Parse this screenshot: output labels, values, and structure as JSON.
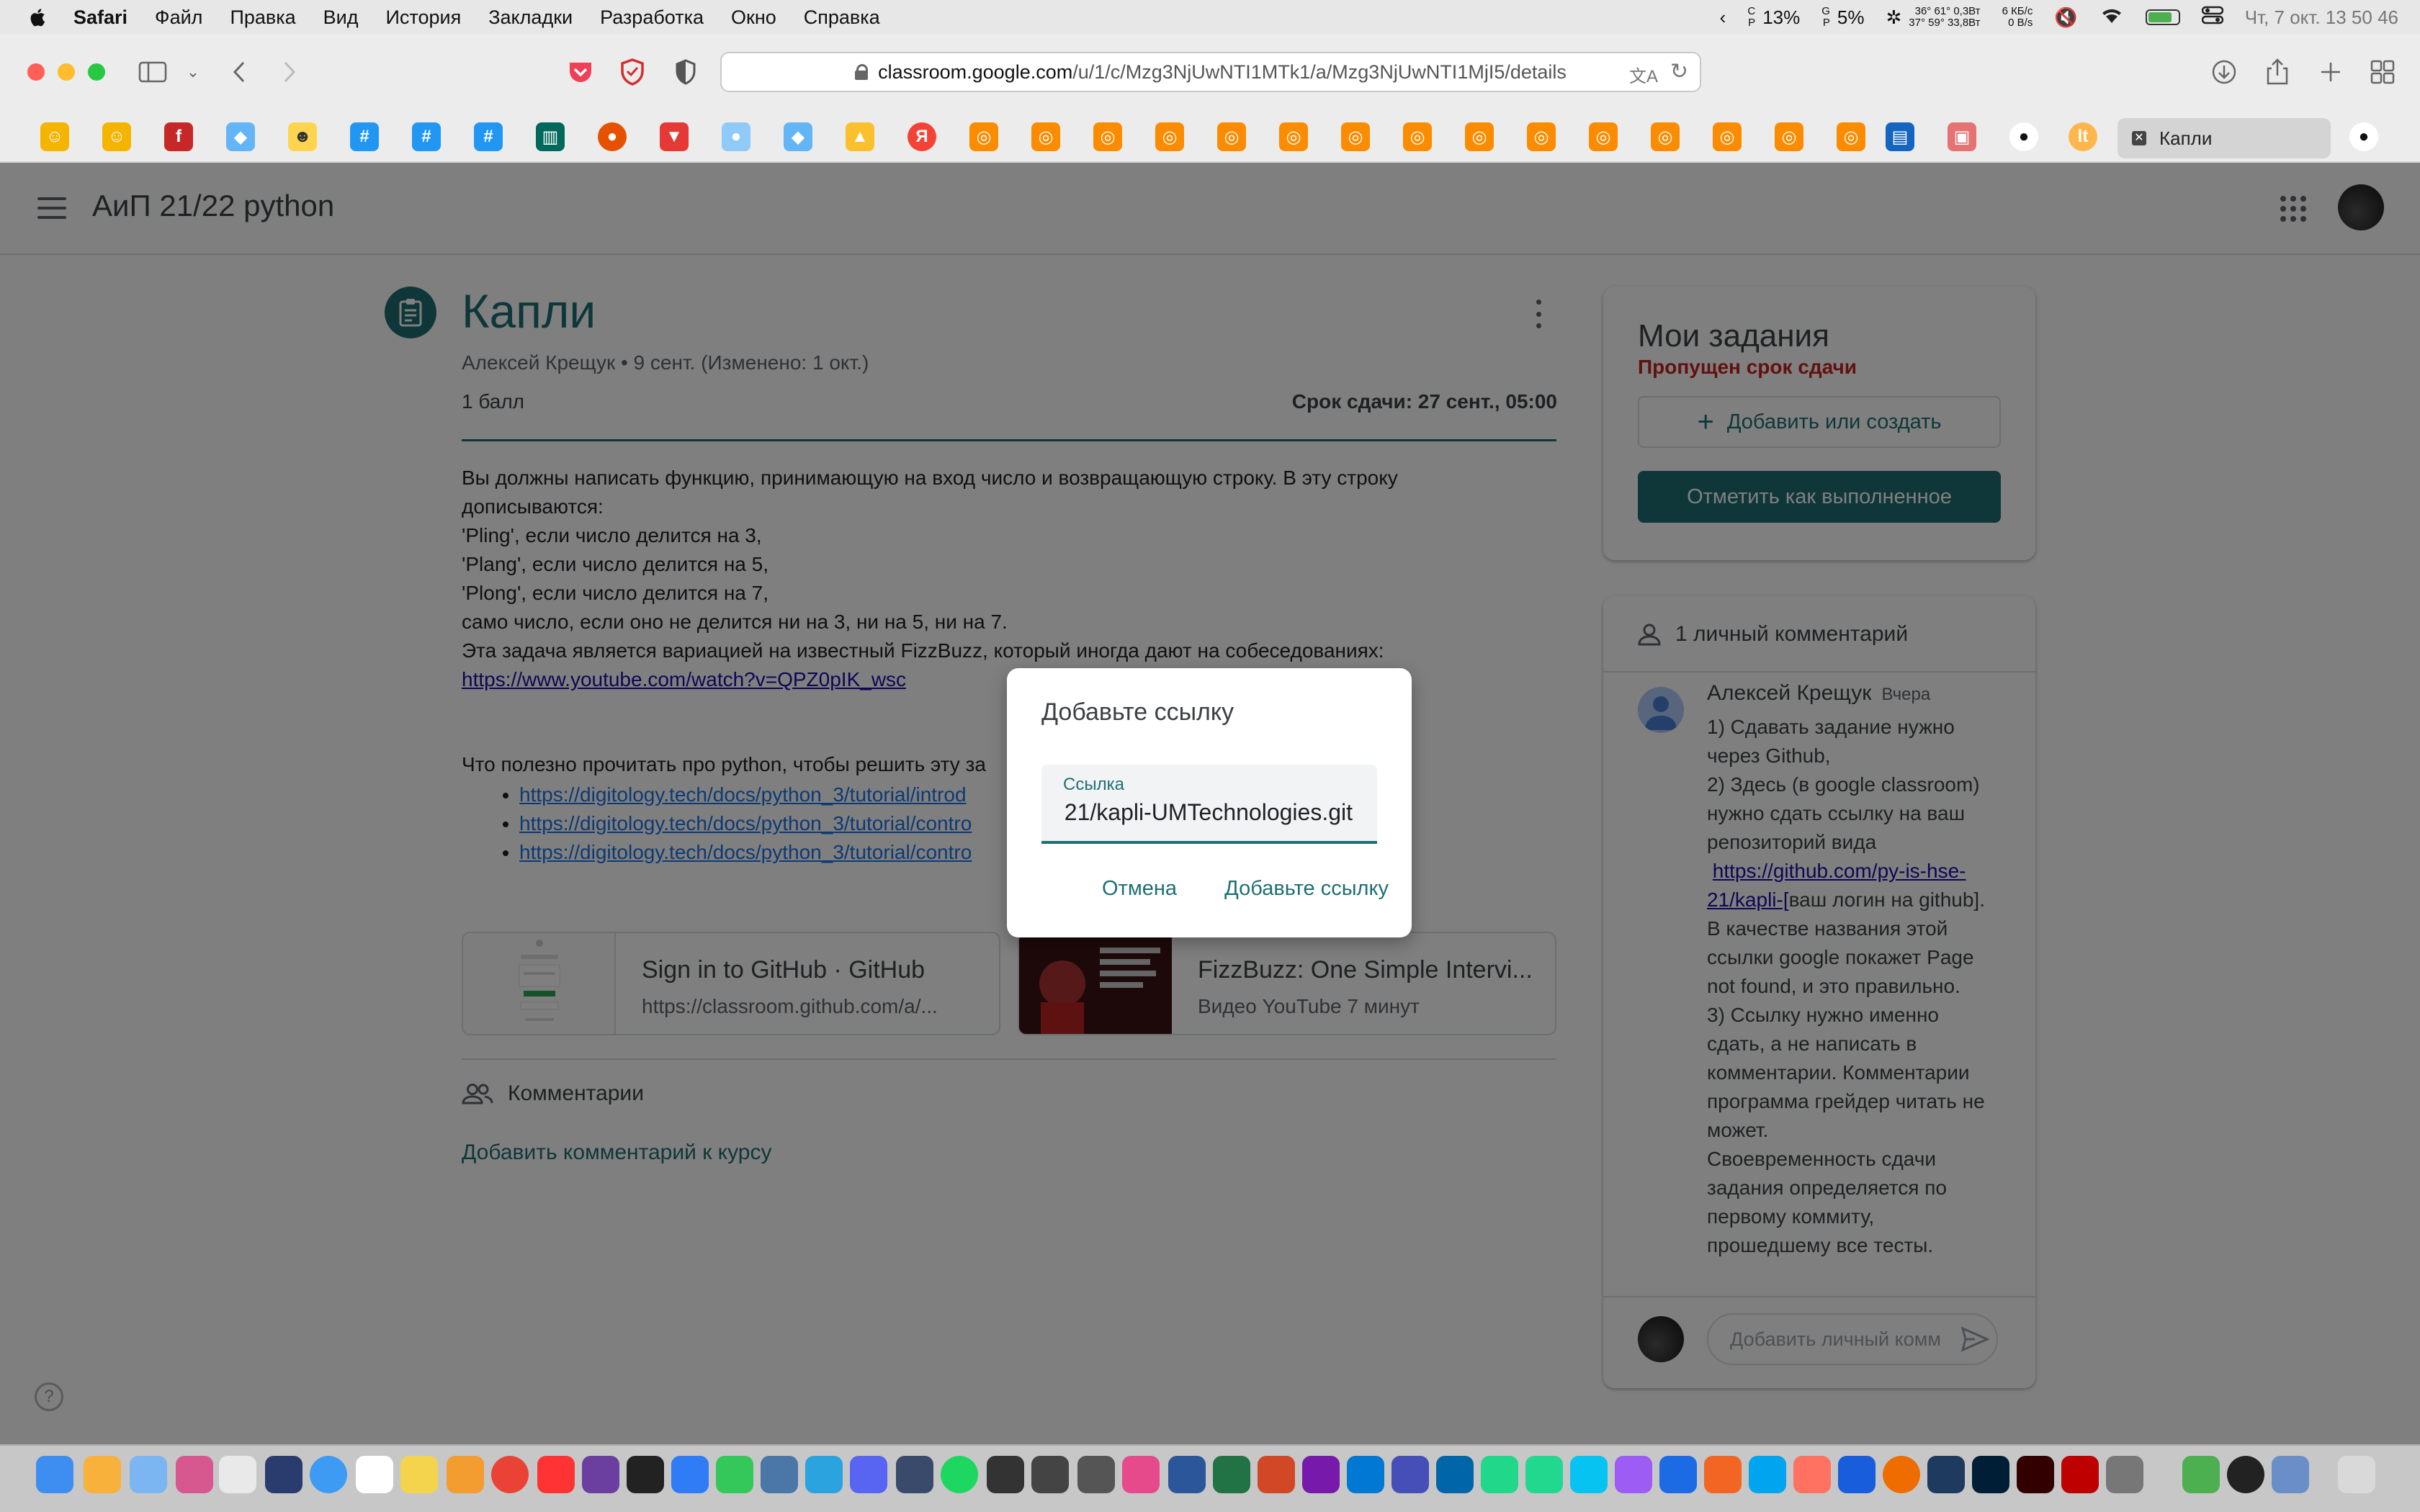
{
  "menubar": {
    "app": "Safari",
    "items": [
      "Файл",
      "Правка",
      "Вид",
      "История",
      "Закладки",
      "Разработка",
      "Окно",
      "Справка"
    ],
    "cpu": "13%",
    "gpu": "5%",
    "temps_top": "36° 61° 0,3Вт",
    "temps_bottom": "37° 59° 33,8Вт",
    "net_up": "6 КБ/с",
    "net_down": "0 B/s",
    "clock": "Чт, 7 окт.  13 50 46"
  },
  "browser": {
    "url_host": "classroom.google.com",
    "url_path": "/u/1/c/Mzg3NjUwNTI1MTk1/a/Mzg3NjUwNTI1MjI5/details",
    "active_tab": "Капли"
  },
  "classroom": {
    "course_title": "АиП 21/22 python",
    "task": {
      "title": "Капли",
      "meta": "Алексей Крещук • 9 сент. (Изменено: 1 окт.)",
      "points": "1 балл",
      "due": "Срок сдачи: 27 сент., 05:00",
      "body_lines": [
        "Вы должны написать функцию, принимающую на вход число и возвращающую строку. В эту строку",
        "дописываются:",
        "'Pling', если число делится на 3,",
        "'Plang', если число делится на 5,",
        "'Plong', если число делится на 7,",
        "само число, если оно не делится ни на 3, ни на 5, ни на 7.",
        "Эта задача является вариацией на известный FizzBuzz, который иногда дают на собеседованиях:"
      ],
      "youtube_link": "https://www.youtube.com/watch?v=QPZ0pIK_wsc",
      "read_label": "Что полезно прочитать про python, чтобы решить эту за",
      "read_links": [
        "https://digitology.tech/docs/python_3/tutorial/introd",
        "https://digitology.tech/docs/python_3/tutorial/contro",
        "https://digitology.tech/docs/python_3/tutorial/contro"
      ]
    },
    "attachments": [
      {
        "title": "Sign in to GitHub · GitHub",
        "subtitle": "https://classroom.github.com/a/..."
      },
      {
        "title": "FizzBuzz: One Simple Intervi...",
        "subtitle": "Видео YouTube   7 минут"
      }
    ],
    "class_comments": {
      "header": "Комментарии",
      "add": "Добавить комментарий к курсу"
    },
    "my_work": {
      "title": "Мои задания",
      "status": "Пропущен срок сдачи",
      "add_button": "Добавить или создать",
      "done_button": "Отметить как выполненное"
    },
    "private_comments": {
      "header": "1 личный комментарий",
      "author": "Алексей Крещук",
      "when": "Вчера",
      "lines": [
        "1) Сдавать задание нужно",
        "через Github,",
        "2) Здесь (в google classroom)",
        "нужно сдать ссылку на ваш",
        "репозиторий вида"
      ],
      "link_part1": "https://github.com/py-is-hse-",
      "link_part2": "21/kapli-[",
      "link_rest": "ваш логин на github].",
      "lines_after": [
        "В качестве названия этой",
        "ссылки google покажет Page",
        "not found, и это правильно.",
        "3) Ссылку нужно именно",
        "сдать, а не написать в",
        "комментарии. Комментарии",
        "программа грейдер читать не",
        "может.",
        "Своевременность сдачи",
        "задания определяется по",
        "первому коммиту,",
        "прошедшему все тесты."
      ],
      "input_placeholder": "Добавить личный комм"
    }
  },
  "dialog": {
    "title": "Добавьте ссылку",
    "field_label": "Ссылка",
    "field_value": "21/kapli-UMTechnologies.git",
    "cancel": "Отмена",
    "confirm": "Добавьте ссылку"
  },
  "colors": {
    "teal": "#1e6f72",
    "missed": "#c5221f"
  }
}
